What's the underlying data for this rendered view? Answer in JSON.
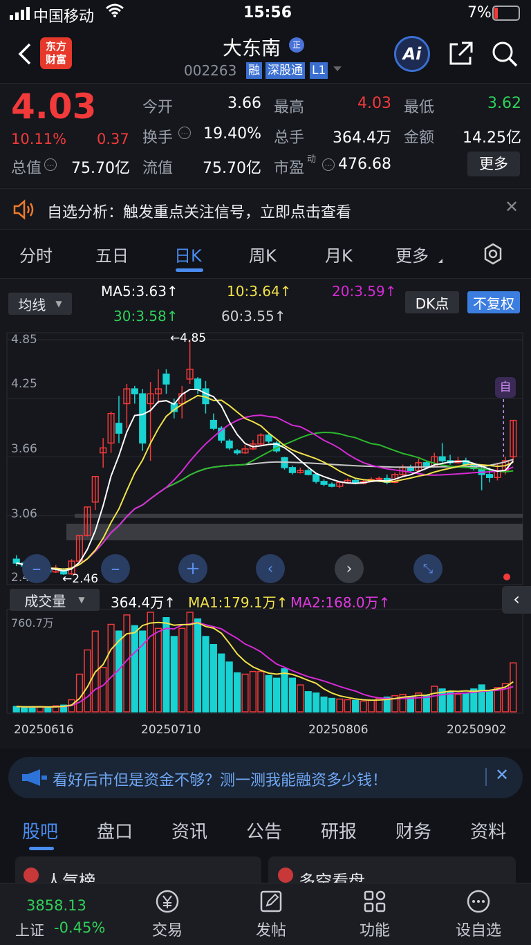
{
  "status_bar": {
    "carrier": "中国移动",
    "time": "15:56",
    "battery": "7%"
  },
  "header": {
    "title": "大东南",
    "badge": "正",
    "code": "002263",
    "tags": [
      "融",
      "深股通",
      "L1"
    ],
    "logo_line1": "东方",
    "logo_line2": "财富",
    "ai_label": "Ai"
  },
  "quote": {
    "price": "4.03",
    "change_pct": "10.11%",
    "change": "0.37",
    "total_value_label": "总值",
    "total_value": "75.70亿",
    "rows": [
      {
        "l1": "今开",
        "v1": "3.66",
        "l2": "最高",
        "v2": "4.03",
        "l3": "最低",
        "v3": "3.62"
      },
      {
        "l1": "换手",
        "v1": "19.40%",
        "l2": "总手",
        "v2": "364.4万",
        "l3": "金额",
        "v3": "14.25亿"
      },
      {
        "l1": "流值",
        "v1": "75.70亿",
        "l2": "市盈",
        "l2_sup": "动",
        "v2": "476.68"
      }
    ],
    "more_label": "更多"
  },
  "notice": {
    "text": "自选分析：触发重点关注信号，立即点击查看"
  },
  "k_tabs": [
    "分时",
    "五日",
    "日K",
    "周K",
    "月K",
    "更多"
  ],
  "k_tab_active": "日K",
  "chart": {
    "indicator_select": "均线",
    "ma_labels": [
      "MA5:3.63↑",
      "10:3.64↑",
      "20:3.59↑",
      "30:3.58↑",
      "60:3.55↑"
    ],
    "dk_label": "DK点",
    "adjust_label": "不复权",
    "y_ticks": [
      "4.85",
      "4.25",
      "3.66",
      "3.06",
      "2.46"
    ],
    "high_marker": "4.85",
    "low_marker": "2.46",
    "self_marker": "自",
    "vol_select": "成交量",
    "vol_labels": [
      "364.4万↑",
      "MA1:179.1万↑",
      "MA2:168.0万↑"
    ],
    "vol_max": "760.7万",
    "dates": [
      "20250616",
      "20250710",
      "20250806",
      "20250902"
    ],
    "colors": {
      "up": "#f23a3a",
      "down": "#19d2d2",
      "ma5": "#ffffff",
      "ma10": "#f2e24a",
      "ma20": "#d62ad6",
      "ma30": "#2db92d",
      "ma60": "#c8c8c8"
    }
  },
  "chart_data": {
    "type": "candlestick",
    "ylim": [
      2.46,
      4.85
    ],
    "candles": [
      {
        "o": 2.62,
        "c": 2.58,
        "h": 2.66,
        "l": 2.55,
        "v": 40
      },
      {
        "o": 2.58,
        "c": 2.55,
        "h": 2.6,
        "l": 2.51,
        "v": 35
      },
      {
        "o": 2.55,
        "c": 2.5,
        "h": 2.57,
        "l": 2.48,
        "v": 38
      },
      {
        "o": 2.5,
        "c": 2.52,
        "h": 2.55,
        "l": 2.46,
        "v": 40
      },
      {
        "o": 2.52,
        "c": 2.49,
        "h": 2.54,
        "l": 2.47,
        "v": 30
      },
      {
        "o": 2.49,
        "c": 2.52,
        "h": 2.56,
        "l": 2.48,
        "v": 45
      },
      {
        "o": 2.52,
        "c": 2.47,
        "h": 2.53,
        "l": 2.46,
        "v": 50
      },
      {
        "o": 2.47,
        "c": 2.6,
        "h": 2.62,
        "l": 2.46,
        "v": 90
      },
      {
        "o": 2.6,
        "c": 2.86,
        "h": 2.86,
        "l": 2.6,
        "v": 280
      },
      {
        "o": 2.86,
        "c": 3.15,
        "h": 3.15,
        "l": 2.85,
        "v": 460
      },
      {
        "o": 3.2,
        "c": 3.46,
        "h": 3.46,
        "l": 3.12,
        "v": 600
      },
      {
        "o": 3.7,
        "c": 3.75,
        "h": 3.85,
        "l": 3.55,
        "v": 330
      },
      {
        "o": 3.8,
        "c": 4.1,
        "h": 4.12,
        "l": 3.7,
        "v": 650
      },
      {
        "o": 4.0,
        "c": 3.9,
        "h": 4.28,
        "l": 3.8,
        "v": 600
      },
      {
        "o": 4.2,
        "c": 4.35,
        "h": 4.4,
        "l": 3.95,
        "v": 720
      },
      {
        "o": 4.35,
        "c": 4.3,
        "h": 4.38,
        "l": 4.2,
        "v": 640
      },
      {
        "o": 4.3,
        "c": 3.8,
        "h": 4.35,
        "l": 3.72,
        "v": 600
      },
      {
        "o": 4.2,
        "c": 4.3,
        "h": 4.42,
        "l": 3.62,
        "v": 740
      },
      {
        "o": 4.3,
        "c": 4.35,
        "h": 4.55,
        "l": 4.2,
        "v": 620
      },
      {
        "o": 4.5,
        "c": 4.4,
        "h": 4.55,
        "l": 4.3,
        "v": 700
      },
      {
        "o": 4.2,
        "c": 4.12,
        "h": 4.25,
        "l": 4.05,
        "v": 560
      },
      {
        "o": 4.2,
        "c": 4.3,
        "h": 4.38,
        "l": 4.05,
        "v": 620
      },
      {
        "o": 4.45,
        "c": 4.55,
        "h": 4.85,
        "l": 4.4,
        "v": 740
      },
      {
        "o": 4.45,
        "c": 4.35,
        "h": 4.47,
        "l": 4.3,
        "v": 690
      },
      {
        "o": 4.35,
        "c": 4.2,
        "h": 4.43,
        "l": 4.1,
        "v": 560
      },
      {
        "o": 4.03,
        "c": 3.95,
        "h": 4.1,
        "l": 3.93,
        "v": 500
      },
      {
        "o": 3.95,
        "c": 3.83,
        "h": 3.97,
        "l": 3.8,
        "v": 430
      },
      {
        "o": 3.82,
        "c": 3.75,
        "h": 3.84,
        "l": 3.73,
        "v": 370
      },
      {
        "o": 3.72,
        "c": 3.7,
        "h": 3.74,
        "l": 3.68,
        "v": 290
      },
      {
        "o": 3.7,
        "c": 3.74,
        "h": 3.78,
        "l": 3.69,
        "v": 280
      },
      {
        "o": 3.74,
        "c": 3.79,
        "h": 3.83,
        "l": 3.73,
        "v": 300
      },
      {
        "o": 3.79,
        "c": 3.88,
        "h": 3.9,
        "l": 3.78,
        "v": 300
      },
      {
        "o": 3.88,
        "c": 3.82,
        "h": 3.9,
        "l": 3.8,
        "v": 270
      },
      {
        "o": 3.8,
        "c": 3.72,
        "h": 3.82,
        "l": 3.7,
        "v": 250
      },
      {
        "o": 3.65,
        "c": 3.55,
        "h": 3.66,
        "l": 3.53,
        "v": 320
      },
      {
        "o": 3.55,
        "c": 3.5,
        "h": 3.57,
        "l": 3.48,
        "v": 250
      },
      {
        "o": 3.5,
        "c": 3.52,
        "h": 3.55,
        "l": 3.49,
        "v": 200
      },
      {
        "o": 3.52,
        "c": 3.48,
        "h": 3.54,
        "l": 3.47,
        "v": 150
      },
      {
        "o": 3.48,
        "c": 3.41,
        "h": 3.49,
        "l": 3.39,
        "v": 140
      },
      {
        "o": 3.41,
        "c": 3.38,
        "h": 3.43,
        "l": 3.36,
        "v": 110
      },
      {
        "o": 3.38,
        "c": 3.36,
        "h": 3.4,
        "l": 3.35,
        "v": 100
      },
      {
        "o": 3.36,
        "c": 3.4,
        "h": 3.41,
        "l": 3.34,
        "v": 95
      },
      {
        "o": 3.4,
        "c": 3.42,
        "h": 3.44,
        "l": 3.39,
        "v": 90
      },
      {
        "o": 3.42,
        "c": 3.39,
        "h": 3.43,
        "l": 3.38,
        "v": 85
      },
      {
        "o": 3.39,
        "c": 3.41,
        "h": 3.42,
        "l": 3.38,
        "v": 80
      },
      {
        "o": 3.41,
        "c": 3.43,
        "h": 3.45,
        "l": 3.4,
        "v": 85
      },
      {
        "o": 3.43,
        "c": 3.44,
        "h": 3.46,
        "l": 3.42,
        "v": 100
      },
      {
        "o": 3.44,
        "c": 3.4,
        "h": 3.48,
        "l": 3.38,
        "v": 110
      },
      {
        "o": 3.4,
        "c": 3.48,
        "h": 3.5,
        "l": 3.39,
        "v": 120
      },
      {
        "o": 3.48,
        "c": 3.55,
        "h": 3.58,
        "l": 3.46,
        "v": 130
      },
      {
        "o": 3.55,
        "c": 3.52,
        "h": 3.58,
        "l": 3.5,
        "v": 110
      },
      {
        "o": 3.52,
        "c": 3.6,
        "h": 3.64,
        "l": 3.51,
        "v": 140
      },
      {
        "o": 3.6,
        "c": 3.56,
        "h": 3.62,
        "l": 3.55,
        "v": 120
      },
      {
        "o": 3.56,
        "c": 3.66,
        "h": 3.7,
        "l": 3.55,
        "v": 190
      },
      {
        "o": 3.66,
        "c": 3.62,
        "h": 3.8,
        "l": 3.6,
        "v": 170
      },
      {
        "o": 3.62,
        "c": 3.6,
        "h": 3.68,
        "l": 3.58,
        "v": 150
      },
      {
        "o": 3.6,
        "c": 3.62,
        "h": 3.66,
        "l": 3.59,
        "v": 130
      },
      {
        "o": 3.62,
        "c": 3.58,
        "h": 3.65,
        "l": 3.56,
        "v": 140
      },
      {
        "o": 3.58,
        "c": 3.54,
        "h": 3.6,
        "l": 3.52,
        "v": 170
      },
      {
        "o": 3.54,
        "c": 3.48,
        "h": 3.56,
        "l": 3.32,
        "v": 200
      },
      {
        "o": 3.48,
        "c": 3.45,
        "h": 3.55,
        "l": 3.4,
        "v": 160
      },
      {
        "o": 3.45,
        "c": 3.52,
        "h": 3.6,
        "l": 3.42,
        "v": 180
      },
      {
        "o": 3.52,
        "c": 3.62,
        "h": 3.66,
        "l": 3.48,
        "v": 210
      },
      {
        "o": 3.66,
        "c": 4.03,
        "h": 4.03,
        "l": 3.62,
        "v": 364
      }
    ]
  },
  "promo": {
    "text": "看好后市但是资金不够？测一测我能融资多少钱！"
  },
  "bottom_tabs": [
    "股吧",
    "盘口",
    "资讯",
    "公告",
    "研报",
    "财务",
    "资料"
  ],
  "bottom_tab_active": "股吧",
  "cards": [
    "人气榜",
    "多空看盘"
  ],
  "bottom_bar": {
    "index_value": "3858.13",
    "index_name": "上证",
    "index_change": "-0.45%",
    "items": [
      "交易",
      "发帖",
      "功能",
      "设自选"
    ]
  }
}
